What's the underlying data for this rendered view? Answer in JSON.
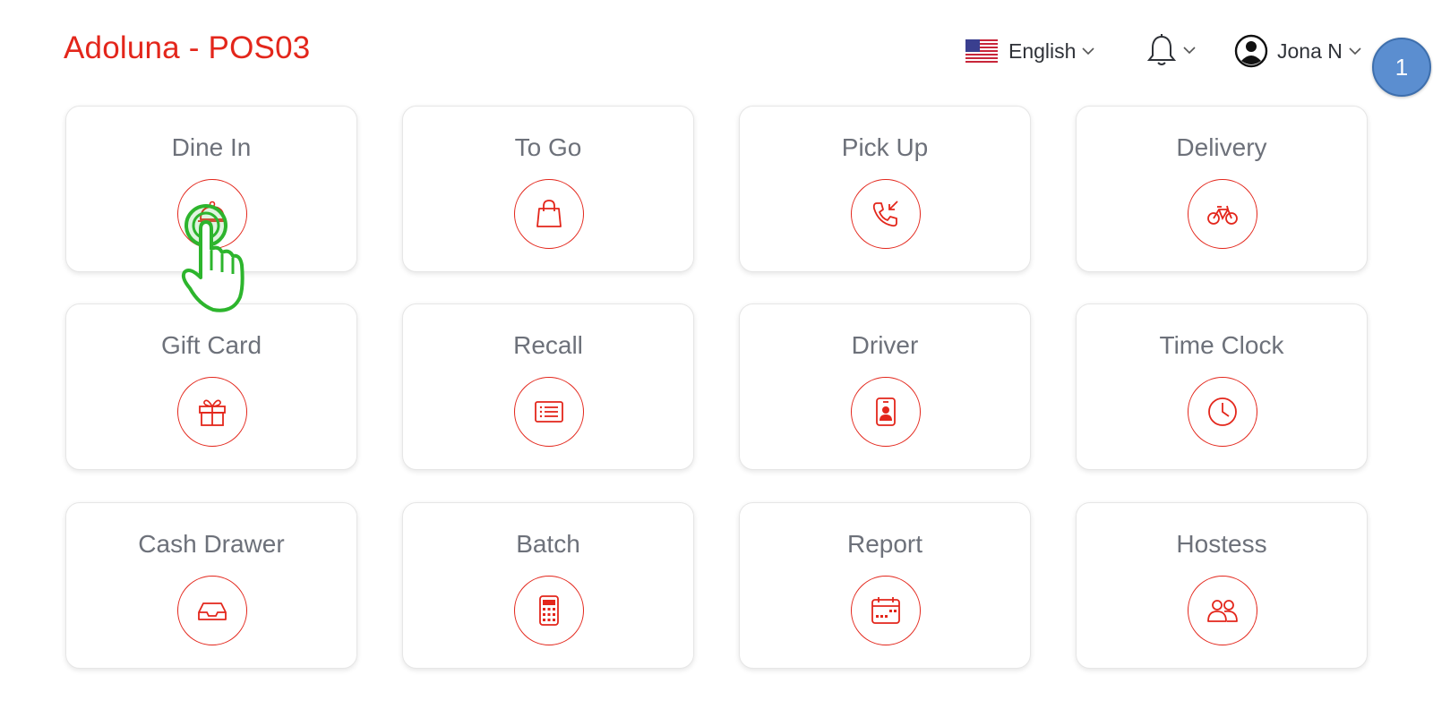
{
  "app": {
    "title": "Adoluna - POS03"
  },
  "header": {
    "language": {
      "label": "English",
      "icon": "us-flag-icon"
    },
    "notifications": {
      "icon": "bell-icon"
    },
    "user": {
      "name": "Jona N",
      "icon": "user-circle-icon"
    }
  },
  "step_badge": "1",
  "tiles": [
    {
      "label": "Dine In",
      "icon": "serving-cloche-icon"
    },
    {
      "label": "To Go",
      "icon": "shopping-bag-icon"
    },
    {
      "label": "Pick Up",
      "icon": "incoming-call-icon"
    },
    {
      "label": "Delivery",
      "icon": "bicycle-icon"
    },
    {
      "label": "Gift Card",
      "icon": "gift-icon"
    },
    {
      "label": "Recall",
      "icon": "receipt-list-icon"
    },
    {
      "label": "Driver",
      "icon": "id-badge-icon"
    },
    {
      "label": "Time Clock",
      "icon": "clock-icon"
    },
    {
      "label": "Cash Drawer",
      "icon": "inbox-tray-icon"
    },
    {
      "label": "Batch",
      "icon": "calculator-icon"
    },
    {
      "label": "Report",
      "icon": "calendar-icon"
    },
    {
      "label": "Hostess",
      "icon": "people-icon"
    }
  ],
  "colors": {
    "brand": "#e3261b",
    "tile_text": "#6d717a",
    "badge": "#5b8ed0",
    "pointer": "#2db52d"
  }
}
